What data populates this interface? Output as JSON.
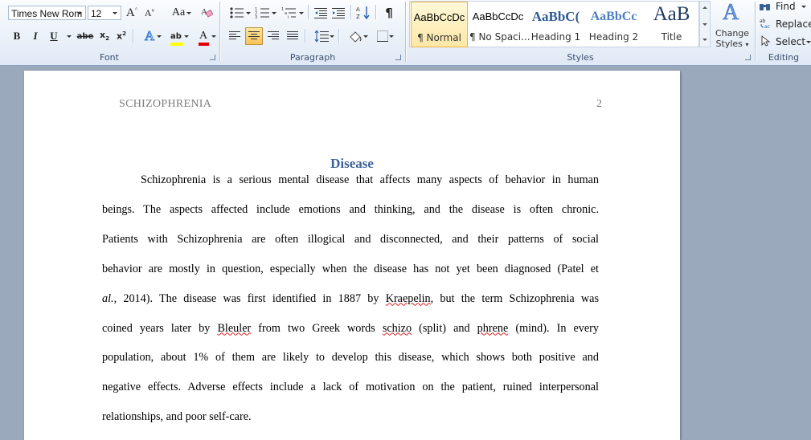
{
  "ribbon": {
    "font": {
      "group_label": "Font",
      "font_name": "Times New Rom",
      "font_size": "12",
      "grow_label": "A",
      "shrink_label": "A",
      "change_case_label": "Aa",
      "bold_label": "B",
      "italic_label": "I",
      "underline_label": "U",
      "strike_label": "abe",
      "subscript_label": "x",
      "superscript_label": "x",
      "text_effects_label": "A",
      "highlight_label": "ab",
      "font_color_label": "A"
    },
    "paragraph": {
      "group_label": "Paragraph",
      "show_marks_label": "¶"
    },
    "styles": {
      "group_label": "Styles",
      "tiles": [
        {
          "sample": "AaBbCcDc",
          "name": "¶ Normal"
        },
        {
          "sample": "AaBbCcDc",
          "name": "¶ No Spaci..."
        },
        {
          "sample": "AaBbC(",
          "name": "Heading 1"
        },
        {
          "sample": "AaBbCc",
          "name": "Heading 2"
        },
        {
          "sample": "AaB",
          "name": "Title"
        }
      ],
      "change_styles_line1": "Change",
      "change_styles_line2": "Styles"
    },
    "editing": {
      "group_label": "Editing",
      "find_label": "Find",
      "replace_label": "Replace",
      "select_label": "Select"
    }
  },
  "document": {
    "running_head": "SCHIZOPHRENIA",
    "page_number": "2",
    "heading": "Disease",
    "lines": [
      {
        "segments": [
          {
            "t": "Schizophrenia is a serious mental disease that affects many aspects of behavior in human"
          }
        ]
      },
      {
        "segments": [
          {
            "t": "beings. The aspects affected include emotions and thinking, and the disease is often chronic."
          }
        ]
      },
      {
        "segments": [
          {
            "t": "Patients with Schizophrenia  are often illogical  and disconnected, and their patterns of social"
          }
        ]
      },
      {
        "segments": [
          {
            "t": "behavior are mostly in question, especially when the disease has not yet been diagnosed (Patel et"
          }
        ]
      },
      {
        "segments": [
          {
            "t": "al.,",
            "s": "it"
          },
          {
            "t": " 2014). The disease was first identified in 1887 by "
          },
          {
            "t": "Kraepelin",
            "s": "sq"
          },
          {
            "t": ", but the term Schizophrenia was"
          }
        ]
      },
      {
        "segments": [
          {
            "t": "coined years later by "
          },
          {
            "t": "Bleuler",
            "s": "sq"
          },
          {
            "t": " from two Greek words "
          },
          {
            "t": "schizo",
            "s": "sq"
          },
          {
            "t": " (split) and "
          },
          {
            "t": "phrene",
            "s": "sq"
          },
          {
            "t": " (mind). In every"
          }
        ]
      },
      {
        "segments": [
          {
            "t": "population, about 1% of them are likely to develop this disease, which shows both positive and"
          }
        ]
      },
      {
        "segments": [
          {
            "t": "negative effects. Adverse effects include a lack of motivation on the patient, ruined interpersonal"
          }
        ]
      },
      {
        "segments": [
          {
            "t": "relationships,  and poor self-care."
          }
        ]
      }
    ]
  },
  "colors": {
    "heading": "#3d6296",
    "running_head": "#7d7d7d",
    "highlight": "#ffff00",
    "font_color": "#e00000",
    "spelling_squiggle": "#e02020"
  },
  "icons": [
    "grow-font-icon",
    "shrink-font-icon",
    "change-case-icon",
    "clear-formatting-icon",
    "bullets-icon",
    "numbering-icon",
    "multilevel-list-icon",
    "decrease-indent-icon",
    "increase-indent-icon",
    "sort-icon",
    "show-marks-icon",
    "align-left-icon",
    "center-icon",
    "align-right-icon",
    "justify-icon",
    "line-spacing-icon",
    "shading-icon",
    "borders-icon",
    "change-styles-icon",
    "binoculars-icon",
    "replace-icon",
    "select-arrow-icon"
  ]
}
